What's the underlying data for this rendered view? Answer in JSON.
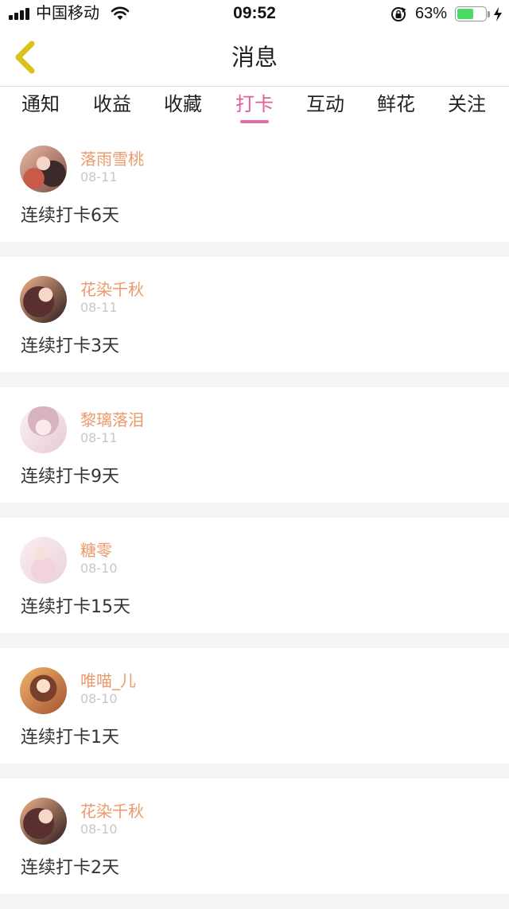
{
  "status_bar": {
    "carrier": "中国移动",
    "time": "09:52",
    "battery_percent": "63%",
    "battery_level": 0.63,
    "icons": [
      "signal-icon",
      "wifi-icon",
      "rotation-lock-icon",
      "battery-icon",
      "charging-icon"
    ]
  },
  "header": {
    "title": "消息",
    "back_icon": "chevron-left-icon",
    "back_icon_color": "#d9c21a"
  },
  "tabs": [
    {
      "label": "通知",
      "active": false
    },
    {
      "label": "收益",
      "active": false
    },
    {
      "label": "收藏",
      "active": false
    },
    {
      "label": "打卡",
      "active": true
    },
    {
      "label": "互动",
      "active": false
    },
    {
      "label": "鲜花",
      "active": false
    },
    {
      "label": "关注",
      "active": false
    }
  ],
  "colors": {
    "accent_pink": "#e0609c",
    "username_orange": "#eb9a6b",
    "date_gray": "#c7c7c7"
  },
  "messages": [
    {
      "user": "落雨雪桃",
      "date": "08-11",
      "text": "连续打卡6天"
    },
    {
      "user": "花染千秋",
      "date": "08-11",
      "text": "连续打卡3天"
    },
    {
      "user": "黎璃落泪",
      "date": "08-11",
      "text": "连续打卡9天"
    },
    {
      "user": "糖零",
      "date": "08-10",
      "text": "连续打卡15天"
    },
    {
      "user": "唯喵_儿",
      "date": "08-10",
      "text": "连续打卡1天"
    },
    {
      "user": "花染千秋",
      "date": "08-10",
      "text": "连续打卡2天"
    }
  ]
}
